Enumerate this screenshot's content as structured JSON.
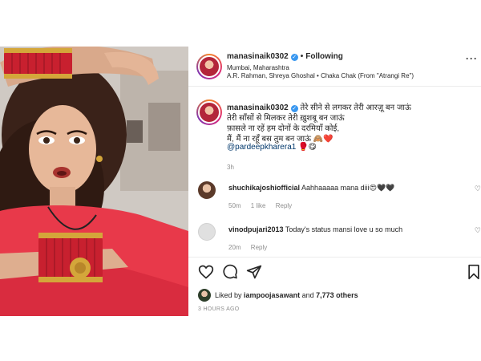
{
  "header": {
    "username": "manasinaik0302",
    "verified_icon": "verified-badge-icon",
    "separator": "•",
    "follow_status": "Following",
    "location": "Mumbai, Maharashtra",
    "audio": "A.R. Rahman, Shreya Ghoshal • Chaka Chak (From \"Atrangi Re\")",
    "more_icon": "more-options-icon"
  },
  "caption": {
    "username": "manasinaik0302",
    "line1": "तेरे सीने से लगकर तेरी आरज़ू बन जाऊं",
    "line2": "तेरी साँसों से मिलकर तेरी ख़ुशबू बन जाऊं",
    "line3": "फ़ासले ना रहें हम दोनों के दरमियाँ कोई,",
    "line4": "मैं, मैं ना रहूँ बस तुम बन जाऊं",
    "line4_emoji": "🙈❤️",
    "mention": "@pardeepkharera1",
    "mention_emoji": "🥊😋",
    "time": "3h"
  },
  "comments": [
    {
      "username": "shuchikajoshiofficial",
      "text": "Aahhaaaaa mana diii",
      "emoji": "😍🖤🖤",
      "time": "50m",
      "likes": "1 like",
      "reply": "Reply"
    },
    {
      "username": "vinodpujari2013",
      "text": "Today's status mansi love u so much",
      "emoji": "",
      "time": "20m",
      "likes": "",
      "reply": "Reply"
    }
  ],
  "actions": {
    "like_icon": "heart-icon",
    "comment_icon": "comment-icon",
    "share_icon": "share-icon",
    "save_icon": "bookmark-icon"
  },
  "likes": {
    "prefix": "Liked by",
    "user": "iampoojasawant",
    "middle": "and",
    "others": "7,773 others"
  },
  "post_time": "3 HOURS AGO",
  "colors": {
    "accent_link": "#00376b",
    "verified": "#3897f0",
    "muted": "#8e8e8e",
    "outfit_red": "#e8394a"
  }
}
